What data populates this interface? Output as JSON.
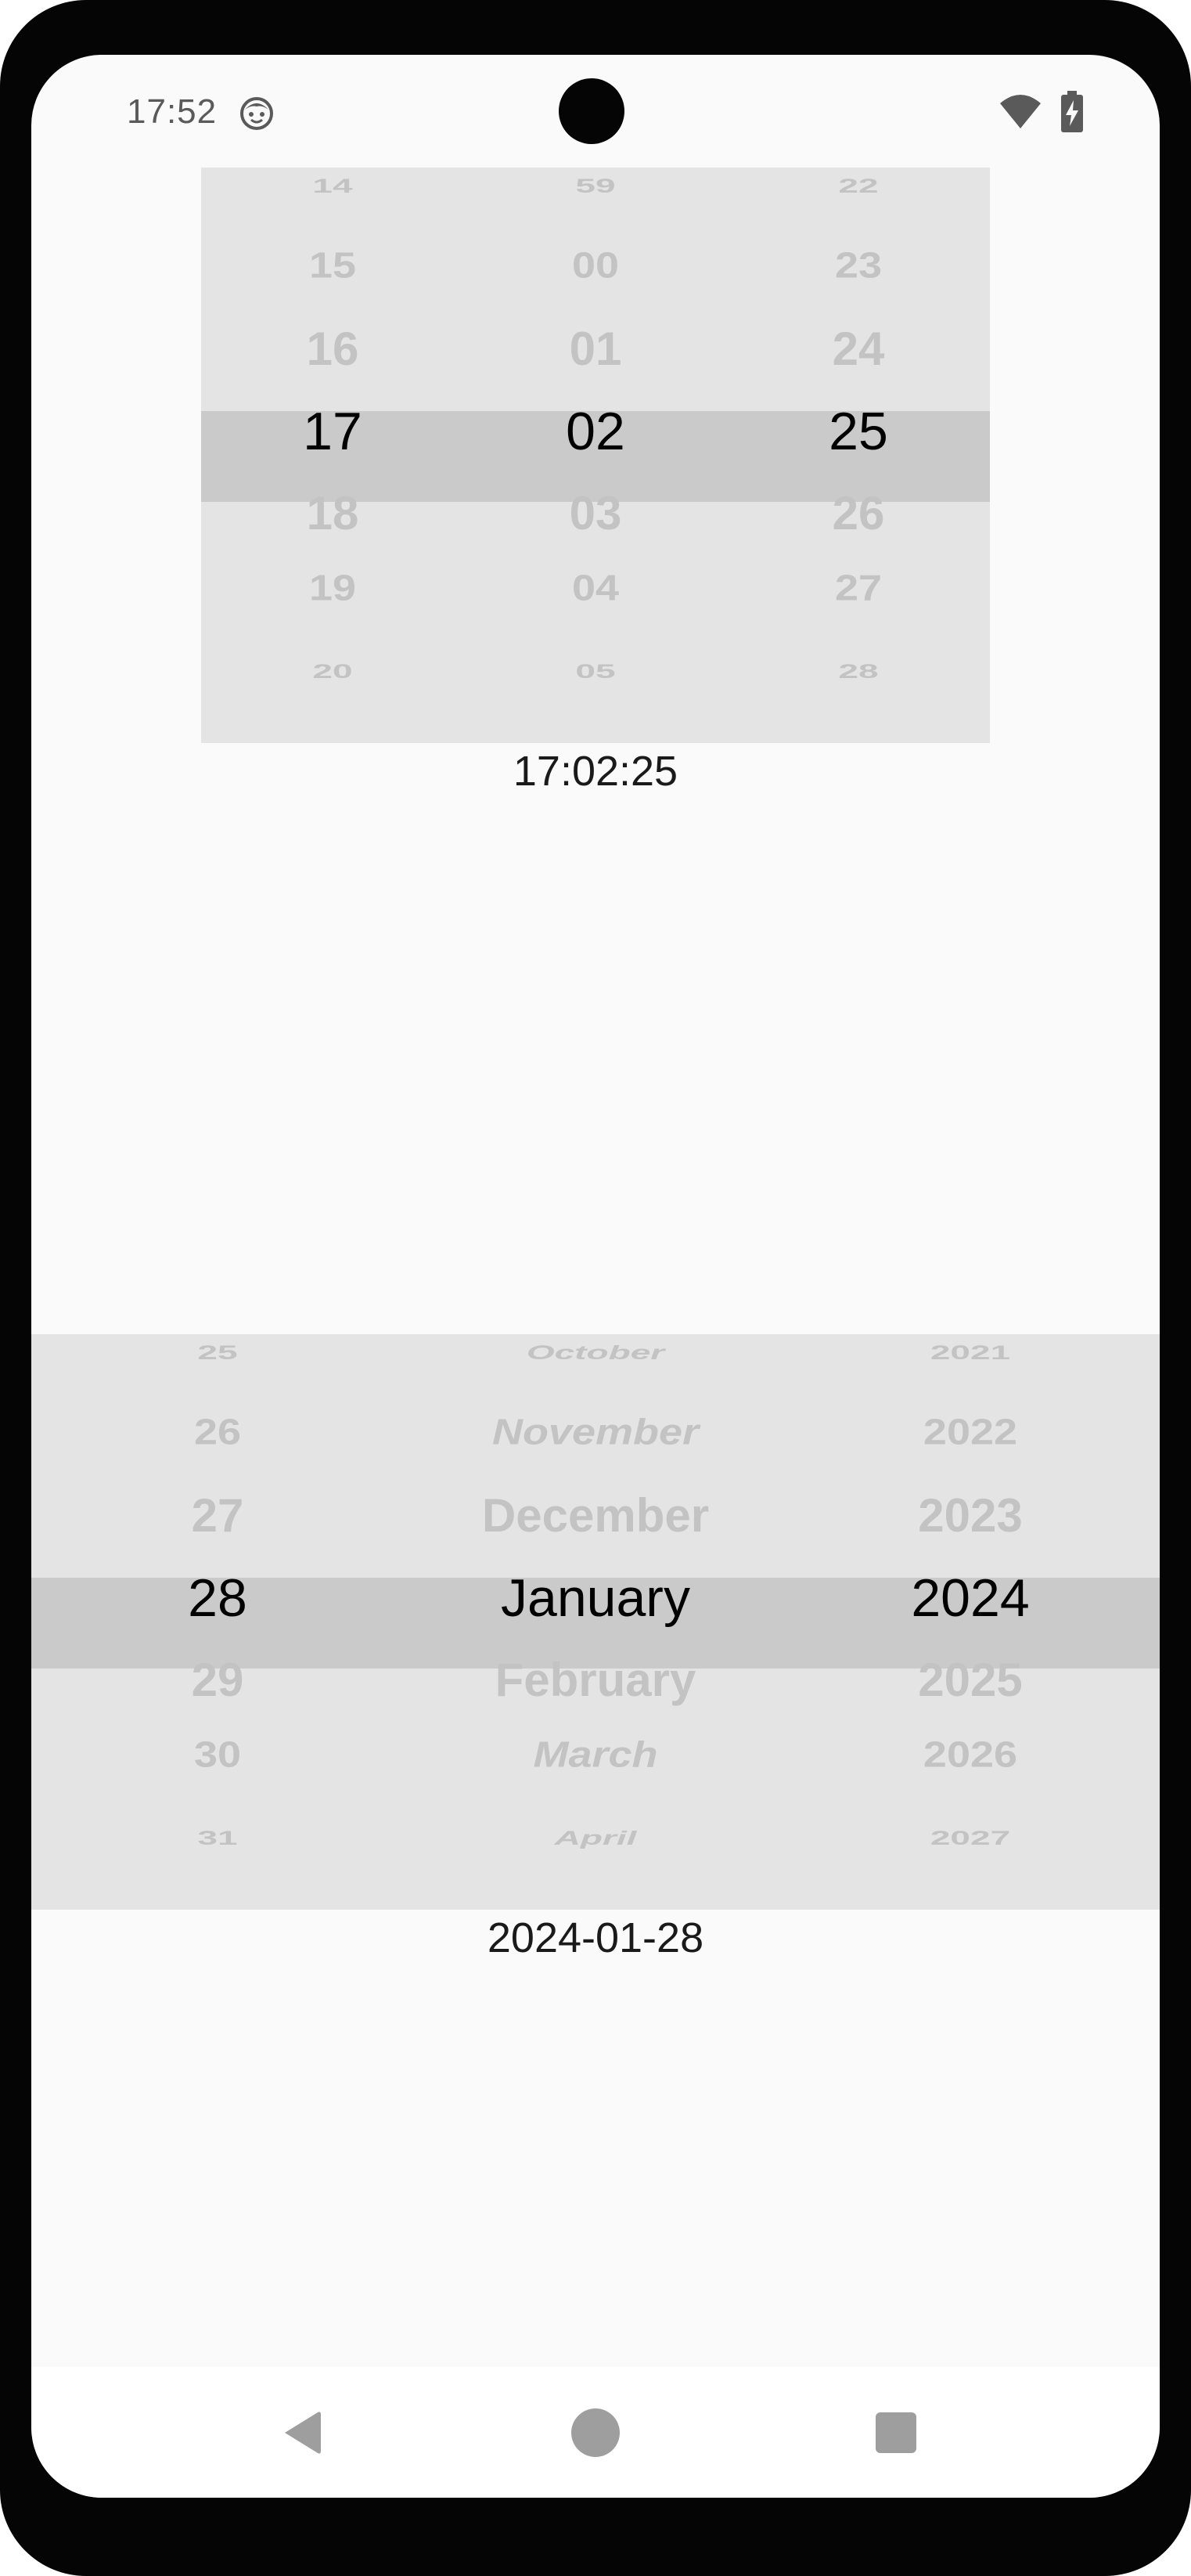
{
  "status_bar": {
    "time": "17:52",
    "icons": [
      "face-notification-icon",
      "wifi-icon",
      "battery-charging-icon"
    ]
  },
  "time_picker": {
    "columns": [
      {
        "items": [
          "14",
          "15",
          "16",
          "17",
          "18",
          "19",
          "20"
        ],
        "selected": "17"
      },
      {
        "items": [
          "59",
          "00",
          "01",
          "02",
          "03",
          "04",
          "05"
        ],
        "selected": "02"
      },
      {
        "items": [
          "22",
          "23",
          "24",
          "25",
          "26",
          "27",
          "28"
        ],
        "selected": "25"
      }
    ],
    "value": "17:02:25"
  },
  "date_picker": {
    "columns": [
      {
        "items": [
          "25",
          "26",
          "27",
          "28",
          "29",
          "30",
          "31"
        ],
        "selected": "28"
      },
      {
        "items": [
          "October",
          "November",
          "December",
          "January",
          "February",
          "March",
          "April"
        ],
        "selected": "January"
      },
      {
        "items": [
          "2021",
          "2022",
          "2023",
          "2024",
          "2025",
          "2026",
          "2027"
        ],
        "selected": "2024"
      }
    ],
    "value": "2024-01-28"
  },
  "nav_bar": {
    "buttons": [
      "back-icon",
      "home-icon",
      "recents-icon"
    ]
  },
  "colors": {
    "screen_bg": "#fafafa",
    "picker_bg": "#e4e4e4",
    "selection_band": "#cacaca",
    "unselected_text": "#c3c3c3",
    "selected_text": "#000000",
    "nav_icon": "#9e9e9e"
  }
}
